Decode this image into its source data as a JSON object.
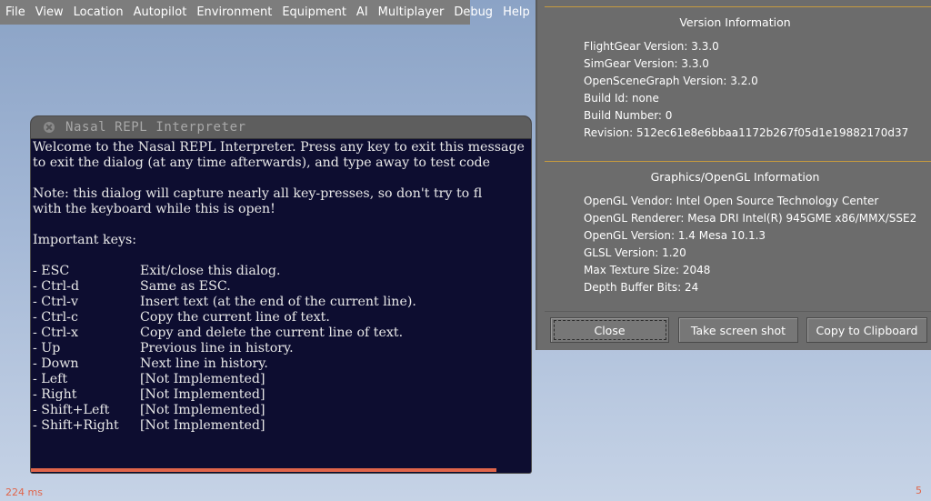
{
  "menubar": {
    "items": [
      "File",
      "View",
      "Location",
      "Autopilot",
      "Environment",
      "Equipment",
      "AI",
      "Multiplayer",
      "Debug",
      "Help"
    ]
  },
  "repl": {
    "title": "Nasal REPL Interpreter",
    "intro_lines": [
      "Welcome to the Nasal REPL Interpreter. Press any key to exit this message",
      "to exit the dialog (at any time afterwards), and type away to test code",
      "",
      "Note: this dialog will capture nearly all key-presses, so don't try to fl",
      "with the keyboard while this is open!",
      "",
      "Important keys:",
      ""
    ],
    "keys": [
      {
        "key": "- ESC",
        "desc": "Exit/close this dialog."
      },
      {
        "key": "- Ctrl-d",
        "desc": "Same as ESC."
      },
      {
        "key": "- Ctrl-v",
        "desc": "Insert text (at the end of the current line)."
      },
      {
        "key": "- Ctrl-c",
        "desc": "Copy the current line of text."
      },
      {
        "key": "- Ctrl-x",
        "desc": "Copy and delete the current line of text."
      },
      {
        "key": "- Up",
        "desc": "Previous line in history."
      },
      {
        "key": "- Down",
        "desc": "Next line in history."
      },
      {
        "key": "- Left",
        "desc": "[Not Implemented]"
      },
      {
        "key": "- Right",
        "desc": "[Not Implemented]"
      },
      {
        "key": "- Shift+Left",
        "desc": "[Not Implemented]"
      },
      {
        "key": "- Shift+Right",
        "desc": "[Not Implemented]"
      }
    ],
    "progress_percent": 93
  },
  "info": {
    "version_title": "Version Information",
    "version_rows": [
      "FlightGear Version: 3.3.0",
      "SimGear Version: 3.3.0",
      "OpenSceneGraph Version: 3.2.0",
      "Build Id: none",
      "Build Number: 0",
      "Revision: 512ec61e8e6bbaa1172b267f05d1e19882170d37"
    ],
    "graphics_title": "Graphics/OpenGL Information",
    "graphics_rows": [
      "OpenGL Vendor: Intel Open Source Technology Center",
      "OpenGL Renderer: Mesa DRI Intel(R) 945GME x86/MMX/SSE2",
      "OpenGL Version: 1.4 Mesa 10.1.3",
      "GLSL Version: 1.20",
      "Max Texture Size: 2048",
      "Depth Buffer Bits: 24"
    ],
    "buttons": {
      "close": "Close",
      "screenshot": "Take screen shot",
      "clipboard": "Copy to Clipboard"
    }
  },
  "status": {
    "frame_time": "224 ms",
    "corner_value": "5"
  },
  "colors": {
    "accent_orange": "#e0654a",
    "separator_gold": "#c69a3f",
    "repl_background": "#0d0d30"
  }
}
